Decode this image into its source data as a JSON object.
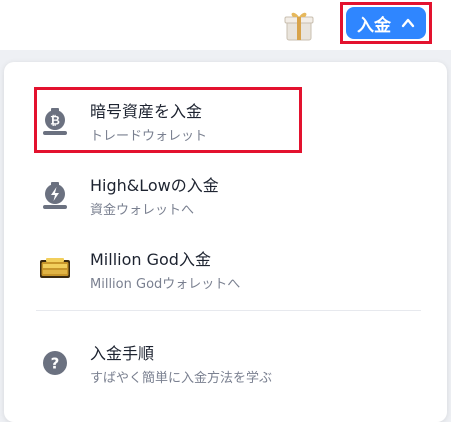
{
  "header": {
    "deposit_button_label": "入金",
    "gift_icon": "gift-icon",
    "chevron_icon": "chevron-up-icon"
  },
  "menu": {
    "items": [
      {
        "icon": "bitcoin-deposit-icon",
        "title": "暗号資産を入金",
        "subtitle": "トレードウォレット"
      },
      {
        "icon": "lightning-deposit-icon",
        "title": "High&Lowの入金",
        "subtitle": "資金ウォレットへ"
      },
      {
        "icon": "million-god-logo-icon",
        "title": "Million God入金",
        "subtitle": "Million Godウォレットへ"
      },
      {
        "icon": "help-icon",
        "title": "入金手順",
        "subtitle": "すばやく簡単に入金方法を学ぶ"
      }
    ]
  },
  "colors": {
    "accent": "#2f86ff",
    "highlight": "#e3122e",
    "icon_gray": "#6b7180"
  }
}
